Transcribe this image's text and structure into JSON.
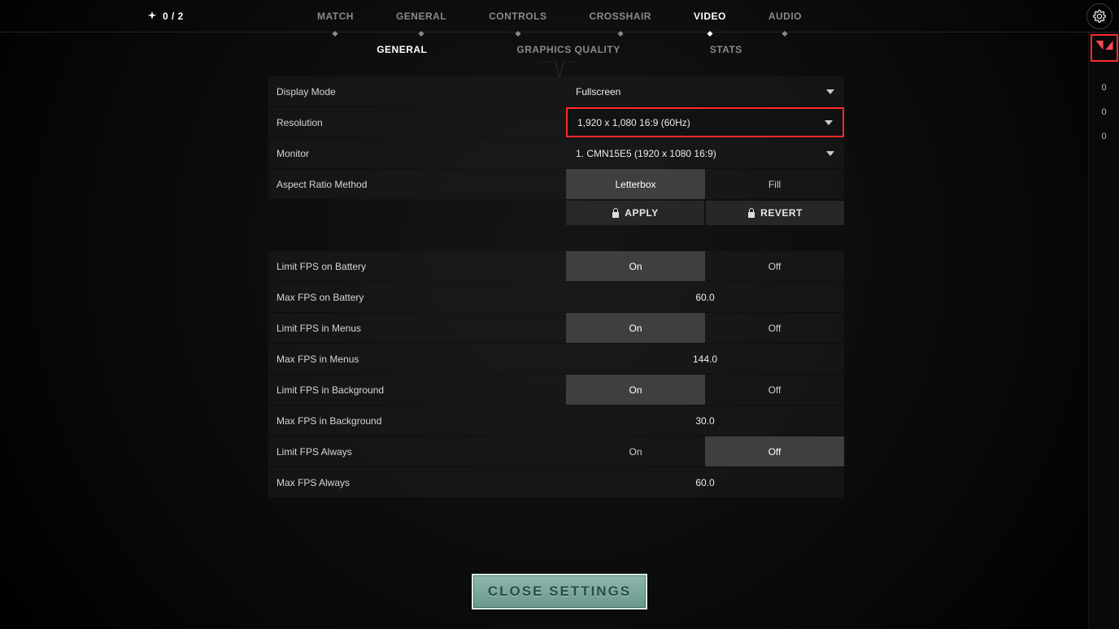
{
  "party": {
    "count_text": "0 / 2"
  },
  "main_tabs": [
    "MATCH",
    "GENERAL",
    "CONTROLS",
    "CROSSHAIR",
    "VIDEO",
    "AUDIO"
  ],
  "main_tab_active_index": 4,
  "sub_tabs": [
    "GENERAL",
    "GRAPHICS QUALITY",
    "STATS"
  ],
  "sub_tab_active_index": 0,
  "right_rail": {
    "values": [
      "0",
      "0",
      "0"
    ]
  },
  "toggle_labels": {
    "on": "On",
    "off": "Off",
    "letterbox": "Letterbox",
    "fill": "Fill"
  },
  "actions": {
    "apply": "APPLY",
    "revert": "REVERT"
  },
  "settings": {
    "display_mode": {
      "label": "Display Mode",
      "value": "Fullscreen"
    },
    "resolution": {
      "label": "Resolution",
      "value": "1,920 x 1,080 16:9 (60Hz)"
    },
    "monitor": {
      "label": "Monitor",
      "value": "1. CMN15E5 (1920 x  1080 16:9)"
    },
    "aspect_ratio": {
      "label": "Aspect Ratio Method",
      "selected": "letterbox"
    },
    "limit_fps_battery": {
      "label": "Limit FPS on Battery",
      "selected": "on"
    },
    "max_fps_battery": {
      "label": "Max FPS on Battery",
      "value": "60.0"
    },
    "limit_fps_menus": {
      "label": "Limit FPS in Menus",
      "selected": "on"
    },
    "max_fps_menus": {
      "label": "Max FPS in Menus",
      "value": "144.0"
    },
    "limit_fps_background": {
      "label": "Limit FPS in Background",
      "selected": "on"
    },
    "max_fps_background": {
      "label": "Max FPS in Background",
      "value": "30.0"
    },
    "limit_fps_always": {
      "label": "Limit FPS Always",
      "selected": "off"
    },
    "max_fps_always": {
      "label": "Max FPS Always",
      "value": "60.0"
    }
  },
  "close_button": "CLOSE SETTINGS"
}
